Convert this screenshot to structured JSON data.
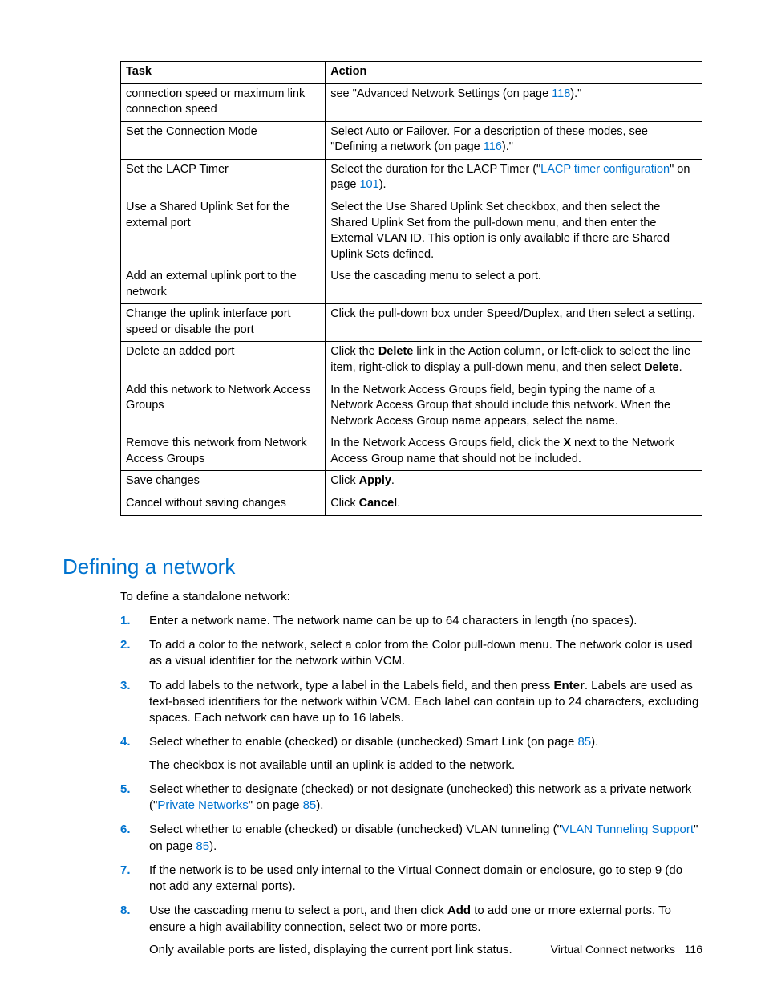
{
  "table": {
    "head": {
      "task": "Task",
      "action": "Action"
    },
    "rows": [
      {
        "task": "connection speed or maximum link connection speed",
        "action_pre": "see \"Advanced Network Settings (on page ",
        "link": "118",
        "action_post": ").\""
      },
      {
        "task": "Set the Connection Mode",
        "action_pre": "Select Auto or Failover. For a description of these modes, see \"Defining a network (on page ",
        "link": "116",
        "action_post": ").\""
      },
      {
        "task": "Set the LACP Timer",
        "action_pre": "Select the duration for the LACP Timer (\"",
        "link": "LACP timer configuration",
        "action_mid": "\" on page ",
        "link2": "101",
        "action_post": ")."
      },
      {
        "task": "Use a Shared Uplink Set for the external port",
        "action_plain": "Select the Use Shared Uplink Set checkbox, and then select the Shared Uplink Set from the pull-down menu, and then enter the External VLAN ID. This option is only available if there are Shared Uplink Sets defined."
      },
      {
        "task": "Add an external uplink port to the network",
        "action_plain": "Use the cascading menu to select a port."
      },
      {
        "task": "Change the uplink interface port speed or disable the port",
        "action_plain": "Click the pull-down box under Speed/Duplex, and then select a setting."
      },
      {
        "task": "Delete an added port",
        "action_pre": "Click the ",
        "bold1": "Delete",
        "action_mid": " link in the Action column, or left-click to select the line item, right-click to display a pull-down menu, and then select ",
        "bold2": "Delete",
        "action_post": "."
      },
      {
        "task": "Add this network to Network Access Groups",
        "action_plain": "In the Network Access Groups field, begin typing the name of a Network Access Group that should include this network. When the Network Access Group name appears, select the name."
      },
      {
        "task": "Remove this network from Network Access Groups",
        "action_pre": "In the Network Access Groups field, click the ",
        "bold1": "X",
        "action_mid": " next to the Network Access Group name that should not be included.",
        "action_post": ""
      },
      {
        "task": "Save changes",
        "action_pre": "Click ",
        "bold1": "Apply",
        "action_post": "."
      },
      {
        "task": "Cancel without saving changes",
        "action_pre": "Click ",
        "bold1": "Cancel",
        "action_post": "."
      }
    ]
  },
  "section": {
    "title": "Defining a network",
    "intro": "To define a standalone network:",
    "steps": {
      "s1": "Enter a network name. The network name can be up to 64 characters in length (no spaces).",
      "s2": "To add a color to the network, select a color from the Color pull-down menu. The network color is used as a visual identifier for the network within VCM.",
      "s3_pre": "To add labels to the network, type a label in the Labels field, and then press ",
      "s3_bold": "Enter",
      "s3_post": ". Labels are used as text-based identifiers for the network within VCM. Each label can contain up to 24 characters, excluding spaces. Each network can have up to 16 labels.",
      "s4_pre": "Select whether to enable (checked) or disable (unchecked) Smart Link (on page ",
      "s4_link": "85",
      "s4_post": ").",
      "s4_p2": "The checkbox is not available until an uplink is added to the network.",
      "s5_pre": "Select whether to designate (checked) or not designate (unchecked) this network as a private network (\"",
      "s5_link1": "Private Networks",
      "s5_mid": "\" on page ",
      "s5_link2": "85",
      "s5_post": ").",
      "s6_pre": "Select whether to enable (checked) or disable (unchecked) VLAN tunneling (\"",
      "s6_link1": "VLAN Tunneling Support",
      "s6_mid": "\" on page ",
      "s6_link2": "85",
      "s6_post": ").",
      "s7": "If the network is to be used only internal to the Virtual Connect domain or enclosure, go to step 9 (do not add any external ports).",
      "s8_pre": "Use the cascading menu to select a port, and then click ",
      "s8_bold": "Add",
      "s8_post": " to add one or more external ports. To ensure a high availability connection, select two or more ports.",
      "s8_p2": "Only available ports are listed, displaying the current port link status."
    }
  },
  "footer": {
    "text": "Virtual Connect networks",
    "page": "116"
  }
}
